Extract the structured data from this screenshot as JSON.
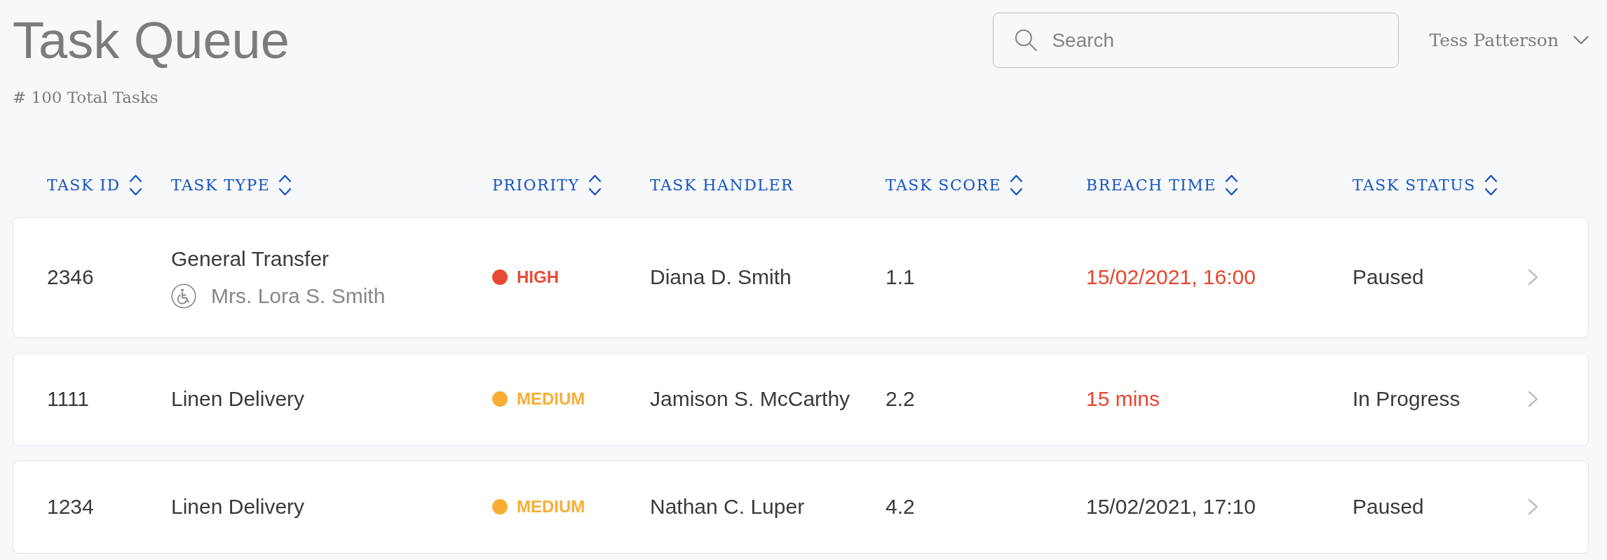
{
  "page": {
    "title": "Task Queue",
    "subtitle": "# 100 Total Tasks"
  },
  "search": {
    "placeholder": "Search"
  },
  "user_menu": {
    "name": "Tess Patterson"
  },
  "table": {
    "columns": [
      {
        "label": "TASK ID",
        "sortable": true
      },
      {
        "label": "TASK TYPE",
        "sortable": true
      },
      {
        "label": "PRIORITY",
        "sortable": true
      },
      {
        "label": "TASK HANDLER",
        "sortable": false
      },
      {
        "label": "TASK SCORE",
        "sortable": true
      },
      {
        "label": "BREACH TIME",
        "sortable": true
      },
      {
        "label": "TASK STATUS",
        "sortable": true
      }
    ],
    "rows": [
      {
        "task_id": "2346",
        "task_type": "General Transfer",
        "patient": "Mrs. Lora S. Smith",
        "priority": {
          "label": "HIGH",
          "color": "#e84a33"
        },
        "handler": "Diana D. Smith",
        "score": "1.1",
        "breach_time": "15/02/2021, 16:00",
        "breached": true,
        "status": "Paused"
      },
      {
        "task_id": "1111",
        "task_type": "Linen Delivery",
        "priority": {
          "label": "MEDIUM",
          "color": "#f8ae35"
        },
        "handler": "Jamison S. McCarthy",
        "score": "2.2",
        "breach_time": "15 mins",
        "breached": true,
        "status": "In Progress"
      },
      {
        "task_id": "1234",
        "task_type": "Linen Delivery",
        "priority": {
          "label": "MEDIUM",
          "color": "#f8ae35"
        },
        "handler": "Nathan C. Luper",
        "score": "4.2",
        "breach_time": "15/02/2021, 17:10",
        "breached": false,
        "status": "Paused"
      }
    ]
  }
}
